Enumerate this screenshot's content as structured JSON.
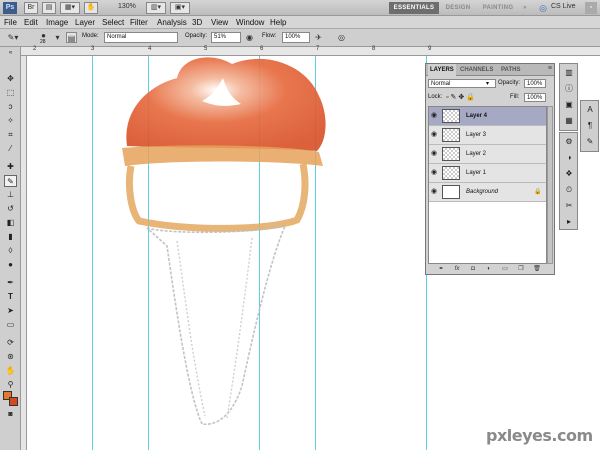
{
  "titlebar": {
    "logo": "Ps",
    "zoom": "130%",
    "workspaces": [
      "ESSENTIALS",
      "DESIGN",
      "PAINTING",
      "»"
    ],
    "cs_live": "CS Live",
    "window_control": "▫"
  },
  "menu": [
    "File",
    "Edit",
    "Image",
    "Layer",
    "Select",
    "Filter",
    "Analysis",
    "3D",
    "View",
    "Window",
    "Help"
  ],
  "options": {
    "brush_size": "28",
    "mode_label": "Mode:",
    "mode_value": "Normal",
    "opacity_label": "Opacity:",
    "opacity_value": "51%",
    "flow_label": "Flow:",
    "flow_value": "100%"
  },
  "ruler": {
    "marks": [
      "2",
      "3",
      "4",
      "5",
      "6",
      "7",
      "8",
      "9"
    ]
  },
  "layers_panel": {
    "tabs": [
      "LAYERS",
      "CHANNELS",
      "PATHS"
    ],
    "blend_mode": "Normal",
    "opacity_label": "Opacity:",
    "opacity_value": "100%",
    "lock_label": "Lock:",
    "fill_label": "Fill:",
    "fill_value": "100%",
    "layers": [
      {
        "name": "Layer 4",
        "selected": true
      },
      {
        "name": "Layer 3",
        "selected": false
      },
      {
        "name": "Layer 2",
        "selected": false
      },
      {
        "name": "Layer 1",
        "selected": false
      },
      {
        "name": "Background",
        "selected": false,
        "locked": true
      }
    ]
  },
  "watermark": "pxleyes.com",
  "colors": {
    "foreground": "#e07a2a",
    "background": "#d24a1e",
    "guide": "#5ad0e0",
    "selected_layer": "#a6a9c4"
  }
}
